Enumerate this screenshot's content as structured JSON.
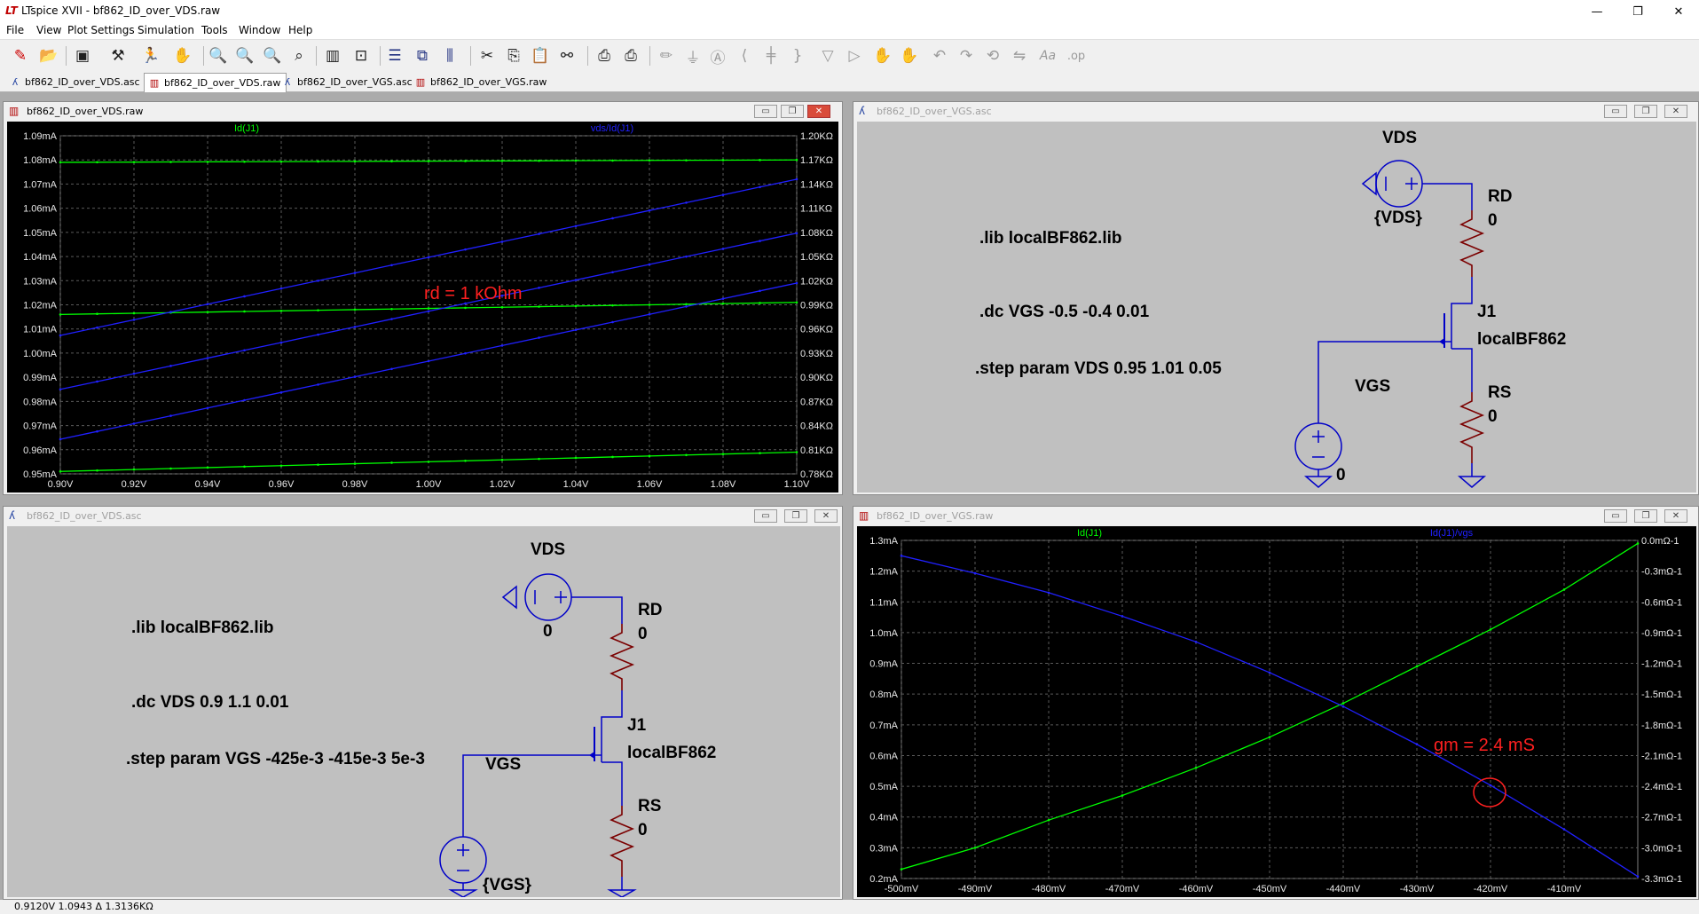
{
  "app": {
    "title": "LTspice XVII - bf862_ID_over_VDS.raw",
    "logo": "LT"
  },
  "window_buttons": {
    "minimize": "—",
    "restore": "❐",
    "close": "✕"
  },
  "menu": [
    "File",
    "View",
    "Plot Settings",
    "Simulation",
    "Tools",
    "Window",
    "Help"
  ],
  "toolbar": [
    "new-schematic-icon",
    "open-icon",
    "save-icon",
    "control-panel-icon",
    "run-icon",
    "halt-icon",
    "pan-icon",
    "zoom-in-icon",
    "zoom-area-icon",
    "zoom-out-icon",
    "zoom-fit-icon",
    "autorange-icon",
    "mark-data-icon",
    "tile-horizontal-icon",
    "cascade-icon",
    "tile-vertical-icon",
    "cut-icon",
    "copy-icon",
    "paste-icon",
    "find-icon",
    "print-icon",
    "print-setup-icon",
    "wire-icon",
    "ground-icon",
    "label-icon",
    "resistor-icon",
    "capacitor-icon",
    "inductor-icon",
    "diode-icon",
    "component-icon",
    "move-icon",
    "drag-icon",
    "undo-icon",
    "redo-icon",
    "rotate-icon",
    "mirror-icon",
    "text-icon",
    "spice-directive-icon"
  ],
  "tabs": [
    {
      "label": "bf862_ID_over_VDS.asc",
      "kind": "asc",
      "active": false
    },
    {
      "label": "bf862_ID_over_VDS.raw",
      "kind": "raw",
      "active": true
    },
    {
      "label": "bf862_ID_over_VGS.asc",
      "kind": "asc",
      "active": false
    },
    {
      "label": "bf862_ID_over_VGS.raw",
      "kind": "raw",
      "active": false
    }
  ],
  "windows": {
    "top_left": {
      "title": "bf862_ID_over_VDS.raw",
      "active": true
    },
    "top_right": {
      "title": "bf862_ID_over_VGS.asc",
      "active": false
    },
    "bottom_left": {
      "title": "bf862_ID_over_VDS.asc",
      "active": false
    },
    "bottom_right": {
      "title": "bf862_ID_over_VGS.raw",
      "active": false
    }
  },
  "colors": {
    "trace_green": "#00ff00",
    "trace_blue": "#2020ff",
    "annotation_red": "#ff2020",
    "plot_bg": "#000000",
    "grid": "#606060",
    "schematic_bg": "#c0c0c0",
    "wire": "#0000c8",
    "component": "#7b0000"
  },
  "chart_data": [
    {
      "type": "line",
      "window": "bf862_ID_over_VDS.raw",
      "legend": [
        "Id(J1)",
        "vds/Id(J1)"
      ],
      "x_label": "",
      "x_ticks": [
        "0.90V",
        "0.92V",
        "0.94V",
        "0.96V",
        "0.98V",
        "1.00V",
        "1.02V",
        "1.04V",
        "1.06V",
        "1.08V",
        "1.10V"
      ],
      "xlim": [
        0.9,
        1.1
      ],
      "y_left_ticks": [
        "1.09mA",
        "1.08mA",
        "1.07mA",
        "1.06mA",
        "1.05mA",
        "1.04mA",
        "1.03mA",
        "1.02mA",
        "1.01mA",
        "1.00mA",
        "0.99mA",
        "0.98mA",
        "0.97mA",
        "0.96mA",
        "0.95mA"
      ],
      "ylim_left": [
        0.95,
        1.09
      ],
      "y_right_ticks": [
        "1.20KΩ",
        "1.17KΩ",
        "1.14KΩ",
        "1.11KΩ",
        "1.08KΩ",
        "1.05KΩ",
        "1.02KΩ",
        "0.99KΩ",
        "0.96KΩ",
        "0.93KΩ",
        "0.90KΩ",
        "0.87KΩ",
        "0.84KΩ",
        "0.81KΩ",
        "0.78KΩ"
      ],
      "ylim_right": [
        0.78,
        1.2
      ],
      "series": [
        {
          "name": "Id(J1)",
          "axis": "left",
          "color": "#00ff00",
          "x": [
            0.9,
            1.1
          ],
          "y": [
            1.079,
            1.08
          ]
        },
        {
          "name": "Id(J1)",
          "axis": "left",
          "color": "#00ff00",
          "x": [
            0.9,
            1.1
          ],
          "y": [
            1.016,
            1.021
          ]
        },
        {
          "name": "Id(J1)",
          "axis": "left",
          "color": "#00ff00",
          "x": [
            0.9,
            1.1
          ],
          "y": [
            0.951,
            0.959
          ]
        },
        {
          "name": "vds/Id(J1)",
          "axis": "right",
          "color": "#2020ff",
          "x": [
            0.9,
            1.1
          ],
          "y": [
            0.952,
            1.146
          ]
        },
        {
          "name": "vds/Id(J1)",
          "axis": "right",
          "color": "#2020ff",
          "x": [
            0.9,
            1.1
          ],
          "y": [
            0.885,
            1.079
          ]
        },
        {
          "name": "vds/Id(J1)",
          "axis": "right",
          "color": "#2020ff",
          "x": [
            0.9,
            1.1
          ],
          "y": [
            0.823,
            1.017
          ]
        }
      ],
      "annotation": "rd = 1 kOhm"
    },
    {
      "type": "line",
      "window": "bf862_ID_over_VGS.raw",
      "legend": [
        "Id(J1)",
        "Id(J1)/vgs"
      ],
      "x_label": "",
      "x_ticks": [
        "-500mV",
        "-490mV",
        "-480mV",
        "-470mV",
        "-460mV",
        "-450mV",
        "-440mV",
        "-430mV",
        "-420mV",
        "-410mV"
      ],
      "xlim": [
        -500,
        -400
      ],
      "y_left_ticks": [
        "1.3mA",
        "1.2mA",
        "1.1mA",
        "1.0mA",
        "0.9mA",
        "0.8mA",
        "0.7mA",
        "0.6mA",
        "0.5mA",
        "0.4mA",
        "0.3mA",
        "0.2mA"
      ],
      "ylim_left": [
        0.2,
        1.3
      ],
      "y_right_ticks": [
        "0.0mΩ-1",
        "-0.3mΩ-1",
        "-0.6mΩ-1",
        "-0.9mΩ-1",
        "-1.2mΩ-1",
        "-1.5mΩ-1",
        "-1.8mΩ-1",
        "-2.1mΩ-1",
        "-2.4mΩ-1",
        "-2.7mΩ-1",
        "-3.0mΩ-1",
        "-3.3mΩ-1"
      ],
      "ylim_right": [
        -3.3,
        0.0
      ],
      "series": [
        {
          "name": "Id(J1)",
          "axis": "left",
          "color": "#00ff00",
          "x": [
            -500,
            -490,
            -480,
            -470,
            -460,
            -450,
            -440,
            -430,
            -420,
            -410,
            -400
          ],
          "y": [
            0.23,
            0.3,
            0.39,
            0.47,
            0.56,
            0.66,
            0.77,
            0.89,
            1.01,
            1.14,
            1.29
          ]
        },
        {
          "name": "Id(J1)/vgs",
          "axis": "right",
          "color": "#2020ff",
          "x": [
            -500,
            -490,
            -480,
            -470,
            -460,
            -450,
            -440,
            -430,
            -420,
            -410,
            -400
          ],
          "y": [
            -0.15,
            -0.32,
            -0.51,
            -0.74,
            -0.99,
            -1.29,
            -1.62,
            -1.99,
            -2.39,
            -2.82,
            -3.28
          ]
        }
      ],
      "annotation": "gm = 2.4 mS"
    }
  ],
  "schematic_vgs": {
    "vds_label": "VDS",
    "vds_value": "{VDS}",
    "rd_label": "RD",
    "rd_value": "0",
    "j1_label": "J1",
    "j1_model": "localBF862",
    "vgs_label": "VGS",
    "vgs_value": "0",
    "rs_label": "RS",
    "rs_value": "0",
    "directives": [
      ".lib localBF862.lib",
      ".dc VGS -0.5 -0.4 0.01",
      ".step param VDS 0.95 1.01 0.05"
    ]
  },
  "schematic_vds": {
    "vds_label": "VDS",
    "vds_value": "0",
    "rd_label": "RD",
    "rd_value": "0",
    "j1_label": "J1",
    "j1_model": "localBF862",
    "vgs_label": "VGS",
    "vgs_value": "{VGS}",
    "rs_label": "RS",
    "rs_value": "0",
    "directives": [
      ".lib localBF862.lib",
      ".dc VDS 0.9 1.1 0.01",
      ".step param VGS -425e-3 -415e-3 5e-3"
    ]
  },
  "status": "0.9120V   1.0943   Δ 1.3136KΩ"
}
